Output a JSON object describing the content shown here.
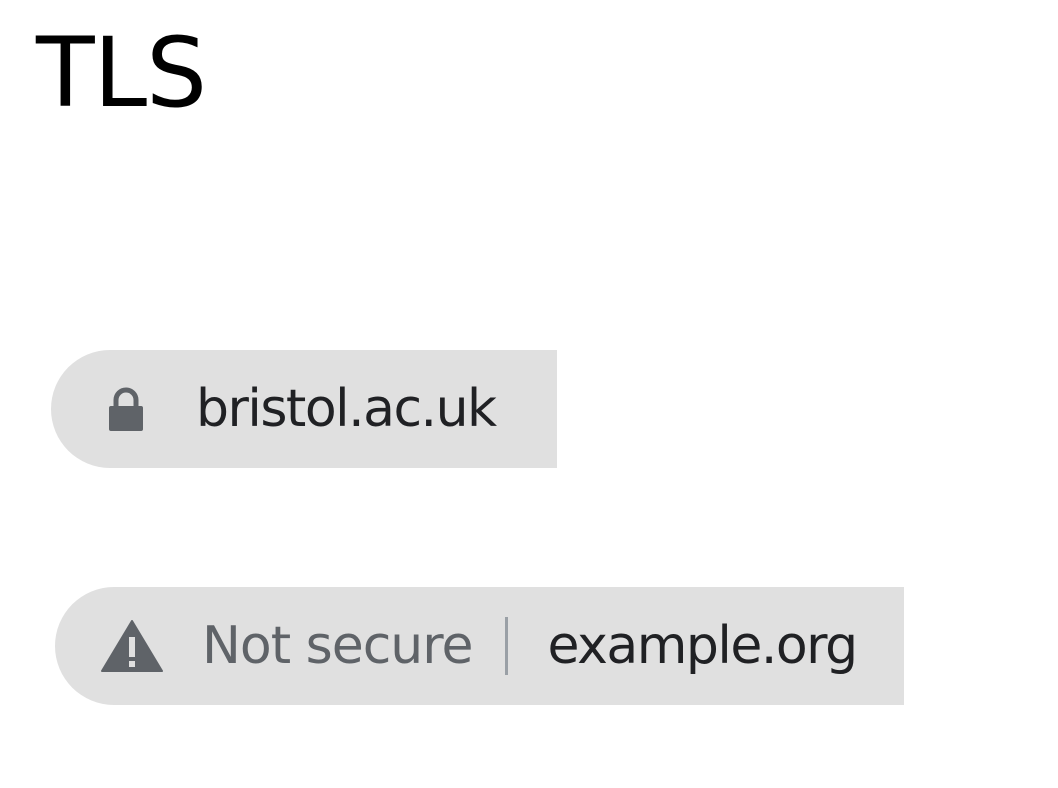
{
  "heading": {
    "text": "TLS"
  },
  "secure_bar": {
    "icon": "lock-icon",
    "domain": "bristol.ac.uk"
  },
  "insecure_bar": {
    "icon": "warning-icon",
    "status": "Not secure",
    "domain": "example.org"
  },
  "colors": {
    "pill_background": "#e0e0e0",
    "icon": "#5f6368",
    "domain_text": "#202124",
    "status_text": "#5f6368",
    "divider": "#9aa0a6"
  }
}
